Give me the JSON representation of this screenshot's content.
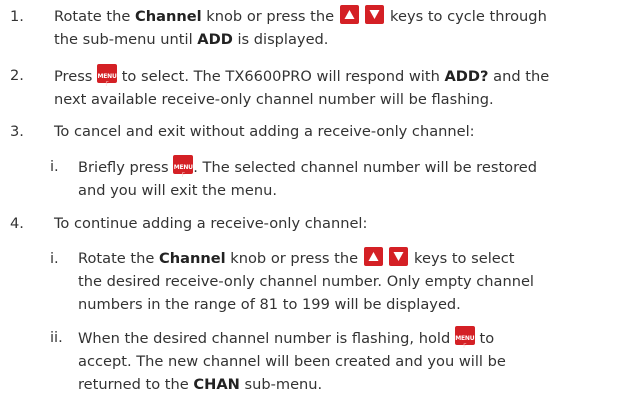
{
  "steps": [
    {
      "num": "1.",
      "l1_a": "Rotate the ",
      "l1_b": "Channel",
      "l1_c": " knob or press the ",
      "l1_d": " keys to cycle through",
      "l2_a": "the sub-menu until ",
      "l2_b": "ADD",
      "l2_c": " is displayed."
    },
    {
      "num": "2.",
      "l1_a": "Press ",
      "l1_b": " to select. The TX6600PRO will respond with ",
      "l1_c": "ADD?",
      "l1_d": " and the",
      "l2": "next available receive-only channel number will be flashing."
    },
    {
      "num": "3.",
      "l1": "To cancel and exit without adding a receive-only channel:",
      "sub": {
        "num": "i.",
        "l1_a": "Briefly press ",
        "l1_b": ". The selected channel number will be restored",
        "l2": "and you will exit the menu."
      }
    },
    {
      "num": "4.",
      "l1": "To continue adding a receive-only channel:",
      "sub1": {
        "num": "i.",
        "l1_a": "Rotate the ",
        "l1_b": "Channel",
        "l1_c": " knob or press the ",
        "l1_d": " keys to select",
        "l2": "the desired receive-only channel number. Only empty channel",
        "l3": "numbers in the range of 81 to 199 will be displayed."
      },
      "sub2": {
        "num": "ii.",
        "l1_a": "When the desired channel number is flashing, hold ",
        "l1_b": " to",
        "l2": "accept. The new channel will been created and you will be",
        "l3_a": "returned to the ",
        "l3_b": "CHAN",
        "l3_c": " sub-menu."
      }
    }
  ],
  "keys": {
    "menu_label": "MENU",
    "menu_sub": "F"
  },
  "icons": {
    "up": "up-arrow-key-icon",
    "down": "down-arrow-key-icon",
    "menu": "menu-key-icon"
  },
  "colors": {
    "key_red": "#d42025",
    "text": "#333333"
  }
}
